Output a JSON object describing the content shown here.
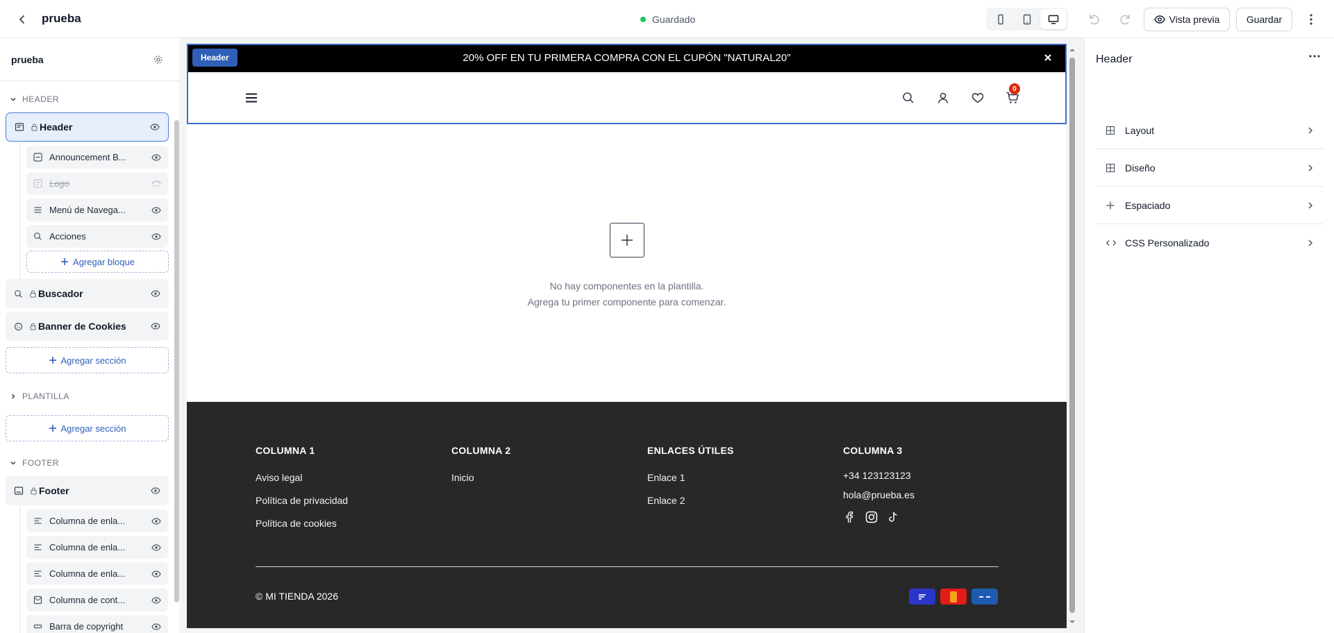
{
  "topbar": {
    "title": "prueba",
    "status": "Guardado",
    "preview_label": "Vista previa",
    "save_label": "Guardar"
  },
  "left": {
    "template_name": "prueba",
    "groups": {
      "header": "HEADER",
      "plantilla": "PLANTILLA",
      "footer": "FOOTER"
    },
    "header_section": "Header",
    "header_blocks": [
      "Announcement B...",
      "Logo",
      "Menú de Navega...",
      "Acciones"
    ],
    "add_block": "Agregar bloque",
    "buscador": "Buscador",
    "cookies": "Banner de Cookies",
    "add_section": "Agregar sección",
    "footer_section": "Footer",
    "footer_blocks": [
      "Columna de enla...",
      "Columna de enla...",
      "Columna de enla...",
      "Columna de cont...",
      "Barra de copyright"
    ]
  },
  "canvas": {
    "header_tag": "Header",
    "announcement": "20% OFF EN TU PRIMERA COMPRA CON EL CUPÓN \"NATURAL20\"",
    "cart_count": "0",
    "empty_line1": "No hay componentes en la plantilla.",
    "empty_line2": "Agrega tu primer componente para comenzar.",
    "footer": {
      "col1": {
        "title": "COLUMNA 1",
        "links": [
          "Aviso legal",
          "Política de privacidad",
          "Política de cookies"
        ]
      },
      "col2": {
        "title": "COLUMNA 2",
        "links": [
          "Inicio"
        ]
      },
      "col3": {
        "title": "ENLACES ÚTILES",
        "links": [
          "Enlace 1",
          "Enlace 2"
        ]
      },
      "col4": {
        "title": "COLUMNA 3",
        "phone": "+34 123123123",
        "email": "hola@prueba.es"
      },
      "copyright": "© MI TIENDA 2026"
    }
  },
  "right": {
    "title": "Header",
    "rows": [
      "Layout",
      "Diseño",
      "Espaciado",
      "CSS Personalizado"
    ]
  },
  "colors": {
    "accent": "#2f5fb7",
    "status_green": "#22c55e",
    "footer_bg": "#282828",
    "cart_badge": "#d72c0d"
  }
}
